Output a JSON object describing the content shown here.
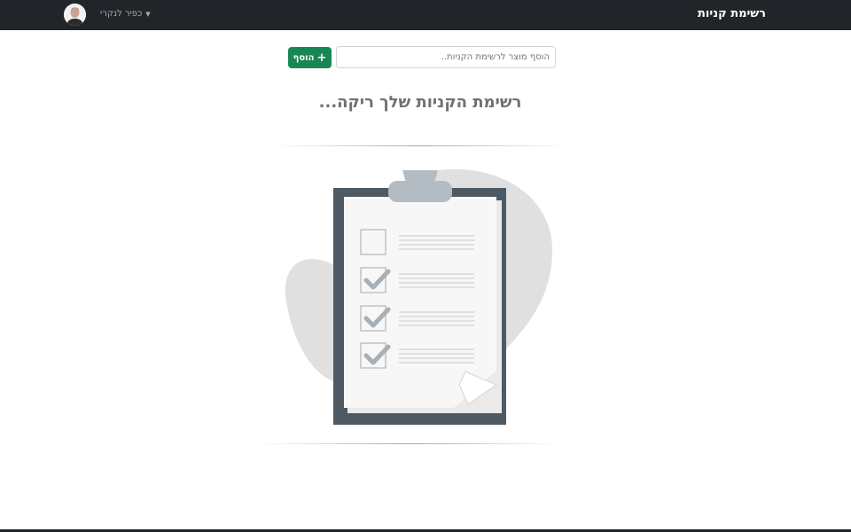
{
  "navbar": {
    "brand": "רשימת קניות",
    "user_name": "כפיר לנקרי"
  },
  "add_form": {
    "input_placeholder": "הוסף מוצר לרשימת הקניות..",
    "add_label": "הוסף"
  },
  "empty_state": {
    "message": "רשימת הקניות שלך ריקה..."
  },
  "colors": {
    "navbar_bg": "#212529",
    "add_button": "#198754",
    "title_text": "#707070"
  },
  "icons": {
    "user_menu_caret": "caret-down-icon",
    "add_button": "plus-icon",
    "illustration": "clipboard-checklist-icon"
  },
  "checklist": {
    "items_checked": [
      false,
      true,
      true,
      true
    ]
  }
}
